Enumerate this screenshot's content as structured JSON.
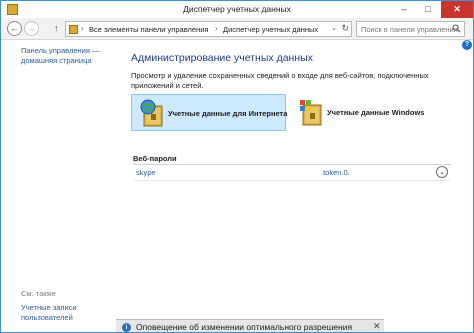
{
  "window": {
    "title": "Диспетчер учетных данных",
    "min": "–",
    "max": "□",
    "close": "✕"
  },
  "nav": {
    "back": "←",
    "forward": "→",
    "up": "↑",
    "address_parts": [
      "Все элементы панели управления",
      "Диспетчер учетных данных"
    ],
    "separator": "›",
    "dropdown": "⌄",
    "refresh": "↻",
    "search_placeholder": "Поиск в панели управления"
  },
  "left_pane": {
    "home_link": "Панель управления — домашняя страница",
    "see_also": "См. также",
    "accounts_link": "Учетные записи пользователей"
  },
  "main": {
    "help": "?",
    "heading": "Администрирование учетных данных",
    "description": "Просмотр и удаление сохраненных сведений о входе для веб-сайтов, подключенных приложений и сетей.",
    "tiles": [
      {
        "label": "Учетные данные для Интернета",
        "icon": "web-credentials-icon",
        "selected": true
      },
      {
        "label": "Учетные данные Windows",
        "icon": "windows-credentials-icon",
        "selected": false
      }
    ],
    "section_title": "Веб-пароли",
    "credentials": [
      {
        "site": "skype",
        "user": ".token.0.",
        "expand": "⌄"
      }
    ]
  },
  "notification": {
    "icon": "i",
    "text": "Оповещение об изменении оптимального разрешения",
    "close": "✕"
  },
  "colors": {
    "accent": "#1f6fc0",
    "link": "#2a5d9c",
    "heading": "#1e3f8c",
    "tile_selected": "#cde8ff",
    "close": "#c7352c"
  }
}
